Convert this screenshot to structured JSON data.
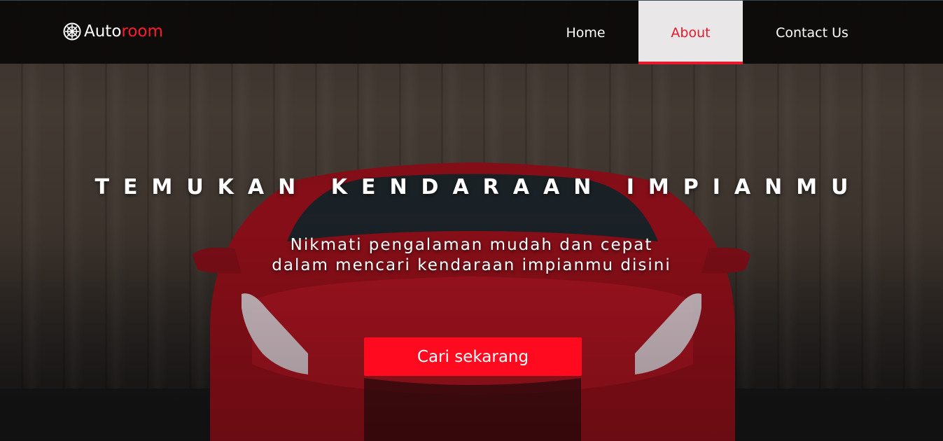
{
  "brand": {
    "name_primary": "Auto",
    "name_accent": "room",
    "icon": "wheel-icon",
    "accent_color": "#ff1a2b"
  },
  "nav": {
    "items": [
      {
        "label": "Home",
        "active": false
      },
      {
        "label": "About",
        "active": true
      },
      {
        "label": "Contact Us",
        "active": false
      }
    ],
    "active_color": "#e8192c",
    "active_background": "#e9e7e7"
  },
  "hero": {
    "title": "TEMUKAN KENDARAAN IMPIANMU",
    "subtitle_line1": "Nikmati pengalaman mudah dan cepat",
    "subtitle_line2": "dalam mencari kendaraan impianmu disini",
    "cta_label": "Cari sekarang",
    "cta_color": "#ff0a1f",
    "background_image": "red sports car parked in front of a dark wooden wall"
  }
}
